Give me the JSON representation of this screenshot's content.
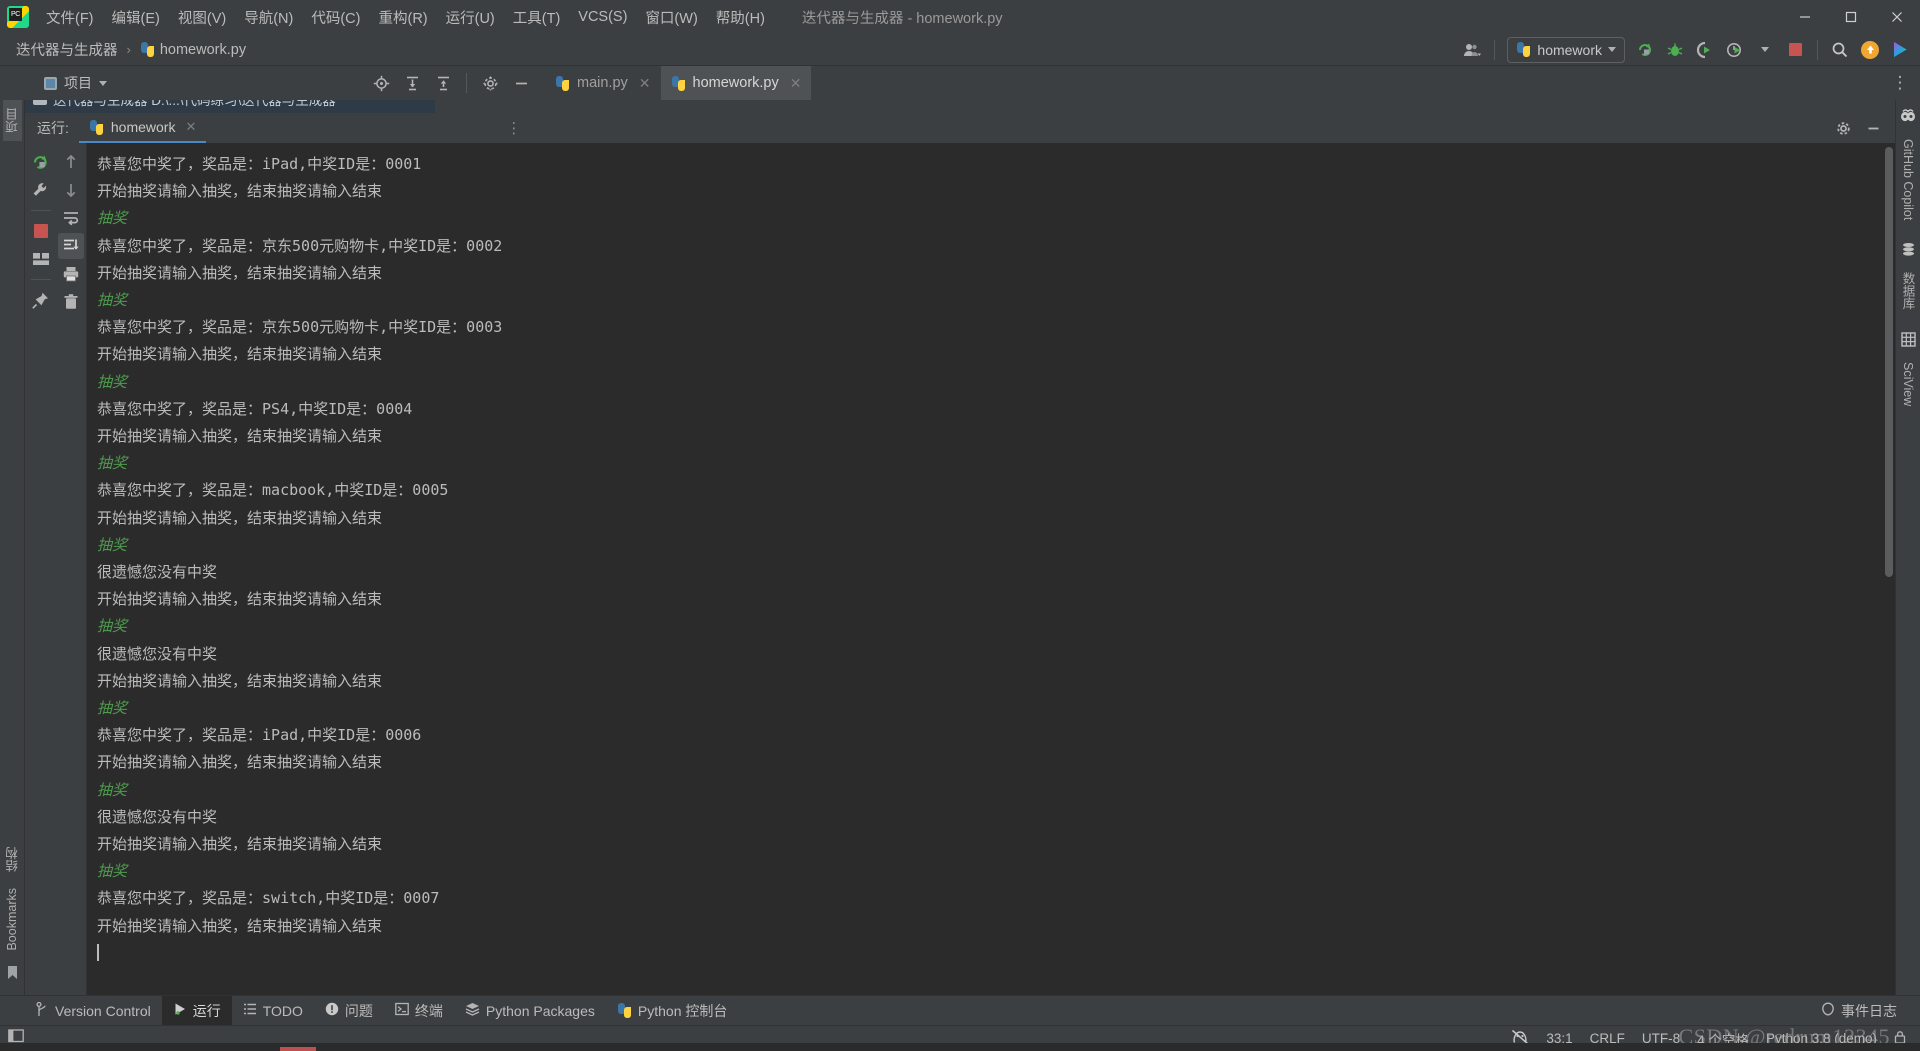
{
  "window": {
    "title": "迭代器与生成器 - homework.py",
    "app_icon": "pycharm-logo-icon",
    "controls": {
      "minimize": "minimize-icon",
      "maximize": "maximize-icon",
      "close": "close-icon"
    }
  },
  "menu": [
    {
      "label": "文件(F)",
      "mnemonic": "F"
    },
    {
      "label": "编辑(E)",
      "mnemonic": "E"
    },
    {
      "label": "视图(V)",
      "mnemonic": "V"
    },
    {
      "label": "导航(N)",
      "mnemonic": "N"
    },
    {
      "label": "代码(C)",
      "mnemonic": "C"
    },
    {
      "label": "重构(R)",
      "mnemonic": "R"
    },
    {
      "label": "运行(U)",
      "mnemonic": "U"
    },
    {
      "label": "工具(T)",
      "mnemonic": "T"
    },
    {
      "label": "VCS(S)",
      "mnemonic": "S"
    },
    {
      "label": "窗口(W)",
      "mnemonic": "W"
    },
    {
      "label": "帮助(H)",
      "mnemonic": "H"
    }
  ],
  "navbar": {
    "breadcrumbs": [
      "迭代器与生成器",
      "homework.py"
    ],
    "separator": "›",
    "run_config": {
      "label": "homework",
      "icon": "python-icon",
      "dropdown": "chevron-down-icon"
    },
    "actions": [
      {
        "name": "rerun-icon",
        "title": "重新运行"
      },
      {
        "name": "debug-icon",
        "title": "调试"
      },
      {
        "name": "run-with-coverage-icon",
        "title": "运行并覆盖"
      },
      {
        "name": "profile-icon",
        "title": "分析"
      },
      {
        "name": "stop-icon",
        "title": "停止"
      },
      {
        "name": "search-everywhere-icon",
        "title": "搜索"
      },
      {
        "name": "update-project-icon",
        "title": "更新"
      },
      {
        "name": "ai-assistant-icon",
        "title": "AI"
      }
    ],
    "account_icon": "user-account-icon"
  },
  "toolwindow_bar": {
    "project_label": "项目",
    "project_icon": "project-panel-icon",
    "dropdown": "chevron-down-icon",
    "actions": [
      {
        "name": "locate-icon"
      },
      {
        "name": "expand-all-icon"
      },
      {
        "name": "collapse-all-icon"
      },
      {
        "name": "settings-gear-icon"
      },
      {
        "name": "hide-icon"
      }
    ],
    "more_icon": "more-vertical-icon"
  },
  "editor_tabs": [
    {
      "label": "main.py",
      "icon": "python-file-icon",
      "active": false,
      "close": "close-icon"
    },
    {
      "label": "homework.py",
      "icon": "python-file-icon",
      "active": true,
      "close": "close-icon"
    }
  ],
  "project_tree_sliver": {
    "row_text": "迭代器与生成器  D:\\...\\代码练习\\迭代器与生成器"
  },
  "run_window": {
    "label": "运行:",
    "tab": {
      "label": "homework",
      "icon": "python-icon",
      "close": "close-icon"
    },
    "header_actions": [
      {
        "name": "settings-gear-icon"
      },
      {
        "name": "hide-window-icon"
      }
    ],
    "gutter_left": [
      {
        "name": "rerun-icon"
      },
      {
        "name": "wrench-icon"
      },
      {
        "name": "stop-icon"
      },
      {
        "name": "layout-icon"
      },
      {
        "name": "pin-icon"
      }
    ],
    "gutter_right": [
      {
        "name": "arrow-up-icon"
      },
      {
        "name": "arrow-down-icon"
      },
      {
        "name": "soft-wrap-icon"
      },
      {
        "name": "scroll-to-end-icon",
        "selected": true
      },
      {
        "name": "print-icon"
      },
      {
        "name": "trash-icon"
      }
    ],
    "console_lines": [
      {
        "text": "恭喜您中奖了，奖品是：iPad,中奖ID是：0001",
        "style": "normal"
      },
      {
        "text": "开始抽奖请输入抽奖，结束抽奖请输入结束",
        "style": "normal"
      },
      {
        "text": "抽奖",
        "style": "input"
      },
      {
        "text": "恭喜您中奖了，奖品是：京东500元购物卡,中奖ID是：0002",
        "style": "normal"
      },
      {
        "text": "开始抽奖请输入抽奖，结束抽奖请输入结束",
        "style": "normal"
      },
      {
        "text": "抽奖",
        "style": "input"
      },
      {
        "text": "恭喜您中奖了，奖品是：京东500元购物卡,中奖ID是：0003",
        "style": "normal"
      },
      {
        "text": "开始抽奖请输入抽奖，结束抽奖请输入结束",
        "style": "normal"
      },
      {
        "text": "抽奖",
        "style": "input"
      },
      {
        "text": "恭喜您中奖了，奖品是：PS4,中奖ID是：0004",
        "style": "normal"
      },
      {
        "text": "开始抽奖请输入抽奖，结束抽奖请输入结束",
        "style": "normal"
      },
      {
        "text": "抽奖",
        "style": "input"
      },
      {
        "text": "恭喜您中奖了，奖品是：macbook,中奖ID是：0005",
        "style": "normal"
      },
      {
        "text": "开始抽奖请输入抽奖，结束抽奖请输入结束",
        "style": "normal"
      },
      {
        "text": "抽奖",
        "style": "input"
      },
      {
        "text": "很遗憾您没有中奖",
        "style": "normal"
      },
      {
        "text": "开始抽奖请输入抽奖，结束抽奖请输入结束",
        "style": "normal"
      },
      {
        "text": "抽奖",
        "style": "input"
      },
      {
        "text": "很遗憾您没有中奖",
        "style": "normal"
      },
      {
        "text": "开始抽奖请输入抽奖，结束抽奖请输入结束",
        "style": "normal"
      },
      {
        "text": "抽奖",
        "style": "input"
      },
      {
        "text": "恭喜您中奖了，奖品是：iPad,中奖ID是：0006",
        "style": "normal"
      },
      {
        "text": "开始抽奖请输入抽奖，结束抽奖请输入结束",
        "style": "normal"
      },
      {
        "text": "抽奖",
        "style": "input"
      },
      {
        "text": "很遗憾您没有中奖",
        "style": "normal"
      },
      {
        "text": "开始抽奖请输入抽奖，结束抽奖请输入结束",
        "style": "normal"
      },
      {
        "text": "抽奖",
        "style": "input"
      },
      {
        "text": "恭喜您中奖了，奖品是：switch,中奖ID是：0007",
        "style": "normal"
      },
      {
        "text": "开始抽奖请输入抽奖，结束抽奖请输入结束",
        "style": "normal"
      }
    ]
  },
  "left_rail": {
    "top": [
      {
        "label": "项目",
        "icon": "project-panel-icon"
      }
    ],
    "bottom": [
      {
        "label": "结构",
        "icon": "structure-icon"
      },
      {
        "label": "Bookmarks",
        "icon": "bookmark-icon"
      }
    ],
    "terminal_icon": "terminal-icon"
  },
  "right_rail": [
    {
      "label": "GitHub Copilot",
      "icon": "copilot-icon"
    },
    {
      "label": "数据库",
      "icon": "database-icon"
    },
    {
      "label": "SciView",
      "icon": "sciview-icon"
    }
  ],
  "bottom_strip": [
    {
      "label": "Version Control",
      "icon": "branch-icon",
      "active": false
    },
    {
      "label": "运行",
      "icon": "run-icon",
      "active": true
    },
    {
      "label": "TODO",
      "icon": "todo-icon",
      "active": false
    },
    {
      "label": "问题",
      "icon": "problems-icon",
      "active": false
    },
    {
      "label": "终端",
      "icon": "terminal-icon",
      "active": false
    },
    {
      "label": "Python Packages",
      "icon": "packages-icon",
      "active": false
    },
    {
      "label": "Python 控制台",
      "icon": "python-console-icon",
      "active": false
    }
  ],
  "event_log": {
    "label": "事件日志",
    "icon": "notification-icon"
  },
  "statusbar": {
    "left_icon": "show-tool-windows-icon",
    "items": [
      {
        "name": "inspections-widget",
        "label": "",
        "icon": "inspections-icon"
      },
      {
        "name": "caret-position",
        "label": "33:1"
      },
      {
        "name": "line-separator",
        "label": "CRLF"
      },
      {
        "name": "file-encoding",
        "label": "UTF-8"
      },
      {
        "name": "indent-size",
        "label": "4 个空格"
      },
      {
        "name": "python-interpreter",
        "label": "Python 3.8 (demo)"
      }
    ],
    "lock_icon": "lock-icon"
  },
  "watermark": "CSDN @redrum12345",
  "colors": {
    "chrome": "#3c3f41",
    "console_bg": "#2b2b2b",
    "text": "#bbbbbb",
    "accent_blue": "#4a88c7",
    "input_green": "#4e9a4e",
    "stop_red": "#c75450",
    "tree_selection": "#2f3a47"
  }
}
